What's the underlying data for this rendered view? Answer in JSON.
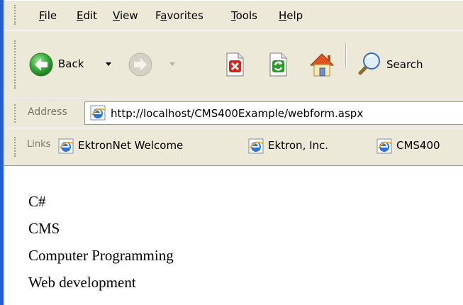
{
  "menu": {
    "items": [
      {
        "label": "File",
        "accel": "F",
        "rest": "ile"
      },
      {
        "label": "Edit",
        "accel": "E",
        "rest": "dit"
      },
      {
        "label": "View",
        "accel": "V",
        "rest": "iew"
      },
      {
        "label": "Favorites",
        "pre": "F",
        "accel": "a",
        "rest": "vorites"
      },
      {
        "label": "Tools",
        "accel": "T",
        "rest": "ools"
      },
      {
        "label": "Help",
        "accel": "H",
        "rest": "elp"
      }
    ]
  },
  "toolbar": {
    "back_label": "Back",
    "search_label": "Search"
  },
  "address": {
    "label": "Address",
    "url": "http://localhost/CMS400Example/webform.aspx"
  },
  "links": {
    "label": "Links",
    "items": [
      "EktronNet Welcome",
      "Ektron, Inc.",
      "CMS400"
    ]
  },
  "content": {
    "lines": [
      "C#",
      "CMS",
      "Computer Programming",
      "Web development"
    ]
  },
  "colors": {
    "back_green": "#2f9a2f",
    "stop_red": "#d9241b",
    "refresh_green": "#2b9b2b",
    "chrome_bg": "#ece9d8",
    "address_border": "#7f9db9"
  }
}
